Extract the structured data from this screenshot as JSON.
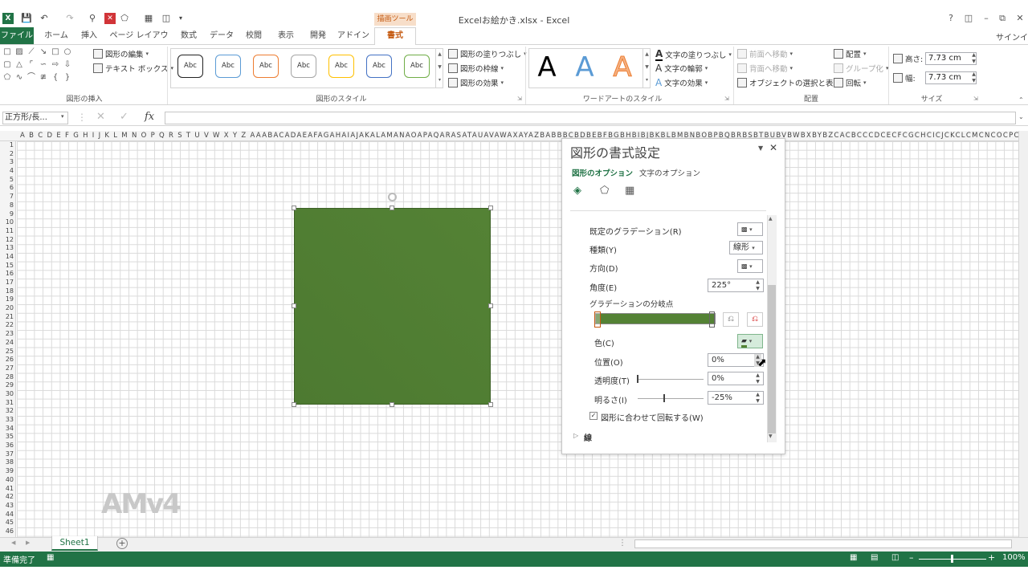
{
  "window": {
    "title": "Excelお絵かき.xlsx - Excel",
    "context_tab_group": "描画ツール",
    "signin": "サインイ",
    "app_icon": "X"
  },
  "tabs": [
    "ファイル",
    "ホーム",
    "挿入",
    "ページ レイアウト",
    "数式",
    "データ",
    "校閲",
    "表示",
    "開発",
    "アドイン",
    "書式"
  ],
  "ribbon": {
    "insert_shapes": {
      "label": "図形の挿入",
      "edit_shape": "図形の編集",
      "text_box": "テキスト ボックス"
    },
    "shape_styles": {
      "label": "図形のスタイル",
      "samples": [
        "Abc",
        "Abc",
        "Abc",
        "Abc",
        "Abc",
        "Abc",
        "Abc"
      ],
      "sample_colors": [
        "#222222",
        "#5b9bd5",
        "#ed7d31",
        "#a5a5a5",
        "#ffc000",
        "#4472c4",
        "#70ad47"
      ],
      "fill": "図形の塗りつぶし",
      "outline": "図形の枠線",
      "effects": "図形の効果"
    },
    "wordart": {
      "label": "ワードアートのスタイル",
      "letters": [
        "A",
        "A",
        "A"
      ],
      "text_fill": "文字の塗りつぶし",
      "text_outline": "文字の輪郭",
      "text_effects": "文字の効果"
    },
    "arrange": {
      "label": "配置",
      "bring_forward": "前面へ移動",
      "send_backward": "背面へ移動",
      "selection_pane": "オブジェクトの選択と表示",
      "align": "配置",
      "group": "グループ化",
      "rotate": "回転"
    },
    "size": {
      "label": "サイズ",
      "height_label": "高さ:",
      "height": "7.73 cm",
      "width_label": "幅:",
      "width": "7.73 cm"
    }
  },
  "formula_bar": {
    "name_box": "正方形/長...",
    "fx": "fx",
    "cancel": "✕",
    "enter": "✓",
    "value": ""
  },
  "grid": {
    "columns_text": "A B C D E F G H I J K L M N O P Q R S T U V W X Y Z AAABACADAEAFAGAHAIAJAKALAMANAOAPAQARASATAUAVAWAXAYAZBABBBCBDBEBFBGBHBIBJBKBLBMBNBOBPBQBRBSBTBUBVBWBXBYBZCACBCCCDCECFCGCHCICJCKCLCMCNCOCPCQCRCSCTCUCVCWCXCYCZDADBDCDDDEDFDGDHDIDJDKDL",
    "rows": [
      1,
      2,
      3,
      4,
      5,
      6,
      7,
      8,
      9,
      10,
      11,
      12,
      13,
      14,
      15,
      16,
      17,
      18,
      19,
      20,
      21,
      22,
      23,
      24,
      25,
      26,
      27,
      28,
      29,
      30,
      31,
      32,
      33,
      34,
      35,
      36,
      37,
      38,
      39,
      40,
      41,
      42,
      43,
      44,
      45,
      46
    ]
  },
  "shape": {
    "fill_color": "#548235"
  },
  "watermark": "AMv4",
  "sheet_tabs": [
    "Sheet1"
  ],
  "status": {
    "ready": "準備完了",
    "zoom": "100%"
  },
  "pane": {
    "title": "図形の書式設定",
    "tab_shape": "図形のオプション",
    "tab_text": "文字のオプション",
    "preset_gradient": "既定のグラデーション(R)",
    "type_label": "種類(Y)",
    "type_value": "線形",
    "direction_label": "方向(D)",
    "angle_label": "角度(E)",
    "angle_value": "225°",
    "stops_label": "グラデーションの分岐点",
    "color_label": "色(C)",
    "position_label": "位置(O)",
    "position_value": "0%",
    "transparency_label": "透明度(T)",
    "transparency_value": "0%",
    "brightness_label": "明るさ(I)",
    "brightness_value": "-25%",
    "rotate_label": "図形に合わせて回転する(W)",
    "rotate_checked": true,
    "line_section": "線"
  }
}
